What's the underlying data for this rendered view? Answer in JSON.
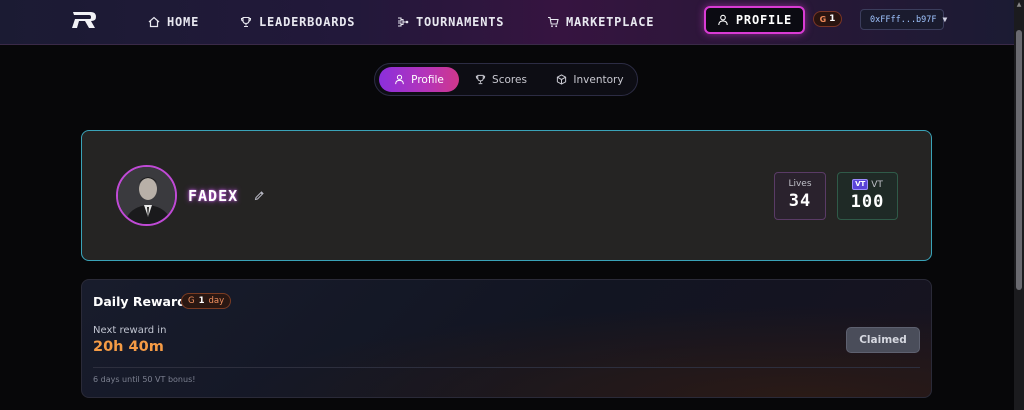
{
  "nav": {
    "items": [
      {
        "label": "HOME",
        "icon": "home-icon"
      },
      {
        "label": "LEADERBOARDS",
        "icon": "trophy-icon"
      },
      {
        "label": "TOURNAMENTS",
        "icon": "bracket-icon"
      },
      {
        "label": "MARKETPLACE",
        "icon": "cart-icon"
      }
    ],
    "profile_label": "PROFILE",
    "coin_count": "1",
    "coin_symbol": "G",
    "wallet": "0xFFff...b97F",
    "wallet_caret": "▼"
  },
  "tabs": [
    {
      "label": "Profile",
      "active": true,
      "icon": "user-icon"
    },
    {
      "label": "Scores",
      "active": false,
      "icon": "trophy-icon"
    },
    {
      "label": "Inventory",
      "active": false,
      "icon": "cube-icon"
    }
  ],
  "profile": {
    "username": "FADEX",
    "lives_label": "Lives",
    "lives_value": "34",
    "vt_badge": "VT",
    "vt_label": "VT",
    "vt_value": "100"
  },
  "daily_reward": {
    "title": "Daily Reward",
    "streak_symbol": "G",
    "streak_count": "1",
    "streak_unit": "day",
    "next_label": "Next reward in",
    "countdown": "20h 40m",
    "claim_label": "Claimed",
    "bonus_note": "6 days until 50 VT bonus!"
  },
  "colors": {
    "accent_magenta": "#d93bd4",
    "card_border_cyan": "#3aa3b8",
    "countdown_orange": "#f59b45"
  }
}
